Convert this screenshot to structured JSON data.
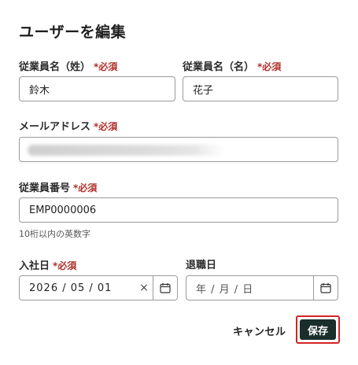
{
  "dialog": {
    "title": "ユーザーを編集"
  },
  "required_mark": "*必須",
  "fields": {
    "last_name": {
      "label": "従業員名（姓）",
      "value": "鈴木"
    },
    "first_name": {
      "label": "従業員名（名）",
      "value": "花子"
    },
    "email": {
      "label": "メールアドレス",
      "value": ""
    },
    "employee_number": {
      "label": "従業員番号",
      "value": "EMP0000006",
      "hint": "10桁以内の英数字"
    },
    "hire_date": {
      "label": "入社日",
      "value": "2026 / 05 / 01",
      "clear_icon": "×"
    },
    "leave_date": {
      "label": "退職日",
      "placeholder": "年 / 月 / 日"
    }
  },
  "actions": {
    "cancel_label": "キャンセル",
    "save_label": "保存"
  },
  "colors": {
    "required": "#b0302a",
    "save_button_bg": "#1a2e2a",
    "highlight_outline": "#d42424"
  },
  "icons": {
    "calendar": "calendar-icon",
    "clear": "clear-icon"
  }
}
